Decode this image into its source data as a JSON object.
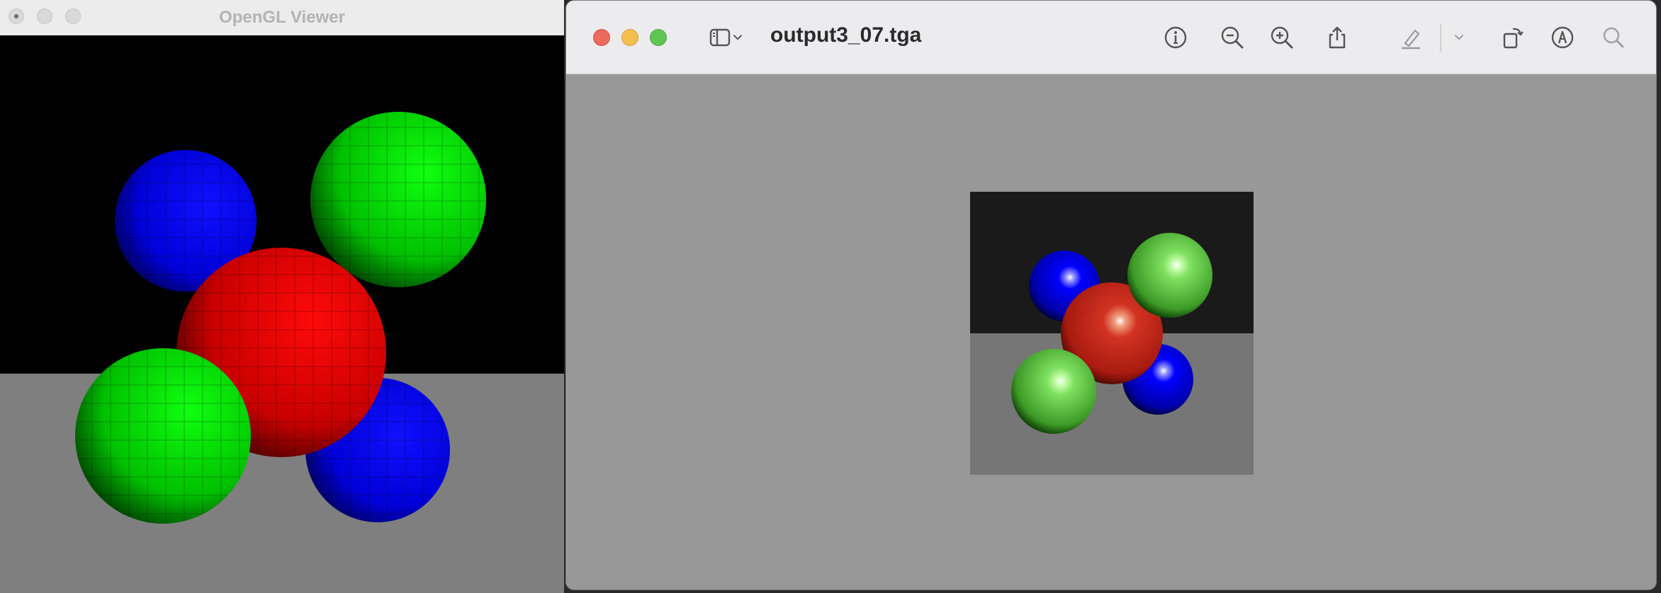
{
  "gl_window": {
    "title": "OpenGL Viewer"
  },
  "preview_window": {
    "filename": "output3_07.tga",
    "toolbar_icons": [
      "sidebar-icon",
      "chevron-down-icon",
      "info-icon",
      "zoom-out-icon",
      "zoom-in-icon",
      "share-icon",
      "highlight-pen-icon",
      "chevron-down-icon",
      "rotate-icon",
      "markup-icon",
      "search-icon"
    ]
  },
  "colors": {
    "close": "#ec6a5e",
    "minimize": "#f4bf4f",
    "maximize": "#61c554",
    "sphere_blue": "#0000ff",
    "sphere_red": "#ff0000",
    "sphere_green": "#00ff00",
    "floor": "#808080"
  }
}
